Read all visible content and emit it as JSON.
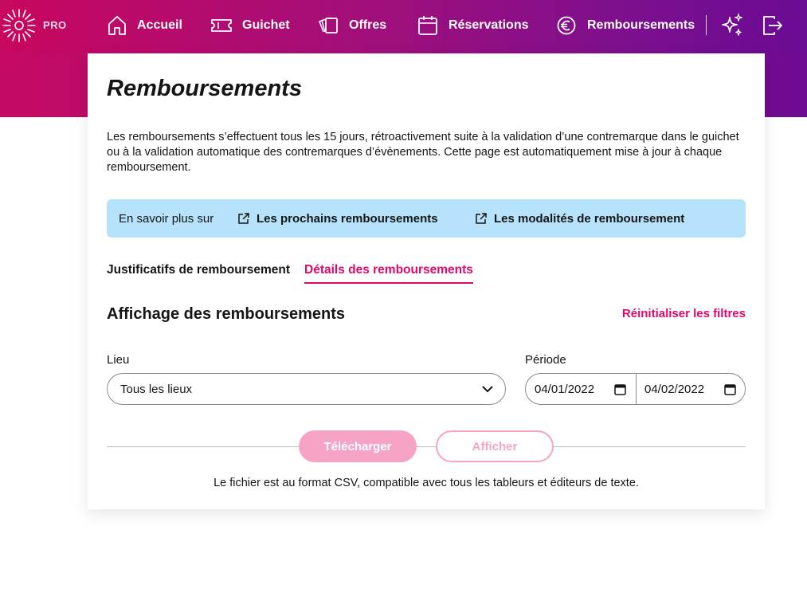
{
  "brand": {
    "logo_text": "PRO"
  },
  "nav": {
    "items": [
      {
        "label": "Accueil",
        "icon": "home-icon"
      },
      {
        "label": "Guichet",
        "icon": "ticket-icon"
      },
      {
        "label": "Offres",
        "icon": "offers-icon"
      },
      {
        "label": "Réservations",
        "icon": "calendar-icon"
      },
      {
        "label": "Remboursements",
        "icon": "euro-icon"
      }
    ],
    "actions": [
      "sparkles-icon",
      "logout-icon"
    ]
  },
  "page": {
    "title": "Remboursements",
    "intro": "Les remboursements s’effectuent tous les 15 jours, rétroactivement suite à la validation d’une contremarque dans le guichet ou à la validation automatique des contremarques d’évènements. Cette page est automatiquement mise à jour à chaque remboursement."
  },
  "info": {
    "label": "En savoir plus sur",
    "links": [
      "Les prochains remboursements",
      "Les modalités de remboursement"
    ]
  },
  "tabs": [
    {
      "label": "Justificatifs de remboursement",
      "active": false
    },
    {
      "label": "Détails des remboursements",
      "active": true
    }
  ],
  "filters": {
    "section_title": "Affichage des remboursements",
    "reset_label": "Réinitialiser les filtres",
    "venue_label": "Lieu",
    "venue_value": "Tous les lieux",
    "period_label": "Période",
    "date_start": "04/01/2022",
    "date_end": "04/02/2022"
  },
  "actions": {
    "download_label": "Télécharger",
    "show_label": "Afficher",
    "footnote": "Le fichier est au format CSV, compatible avec tous les tableurs et éditeurs de texte."
  },
  "colors": {
    "accent": "#e00867",
    "accent_disabled": "#f5a4c6",
    "info_bg": "#b6e3fb",
    "gradient_start": "#c8075f",
    "gradient_end": "#6a0b93"
  }
}
